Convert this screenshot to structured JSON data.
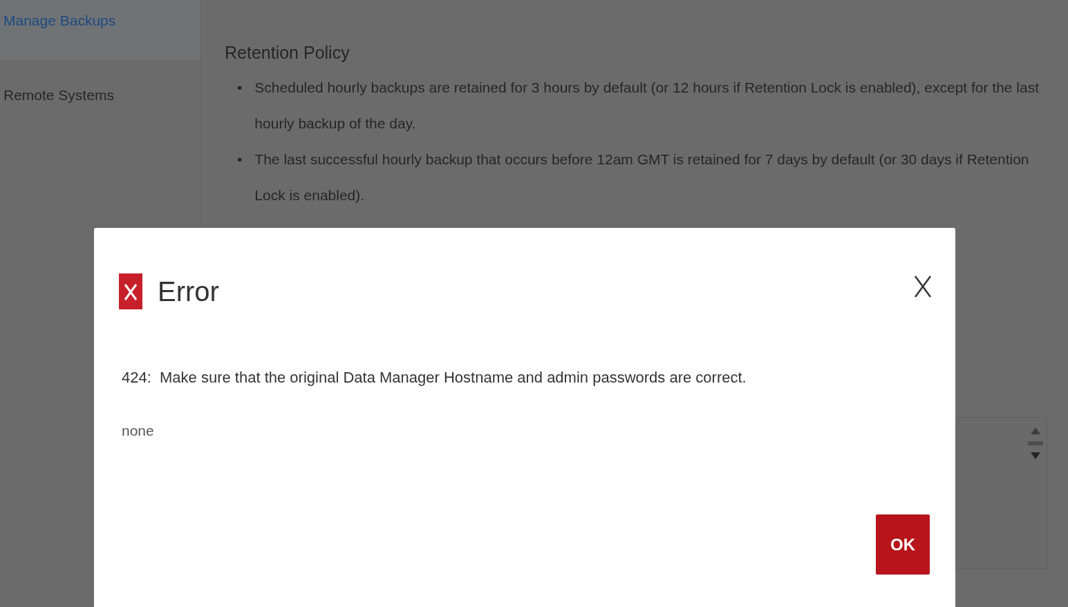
{
  "sidebar": {
    "items": [
      {
        "label": "Manage Backups",
        "selected": true
      },
      {
        "label": "Remote Systems",
        "selected": false
      }
    ]
  },
  "content": {
    "heading": "Retention Policy",
    "bullets": [
      {
        "marker": "•",
        "text": "Scheduled hourly backups are retained for 3 hours by default (or 12 hours if Retention Lock is enabled), except for the last hourly backup of the day."
      },
      {
        "marker": "•",
        "text": "The last successful hourly backup that occurs before 12am GMT is retained for 7 days by default (or 30 days if Retention Lock is enabled)."
      }
    ]
  },
  "dialog": {
    "title": "Error",
    "message": "424:  Make sure that the original Data Manager Hostname and admin passwords are correct.",
    "detail": "none",
    "buttons": [
      "OK"
    ]
  }
}
